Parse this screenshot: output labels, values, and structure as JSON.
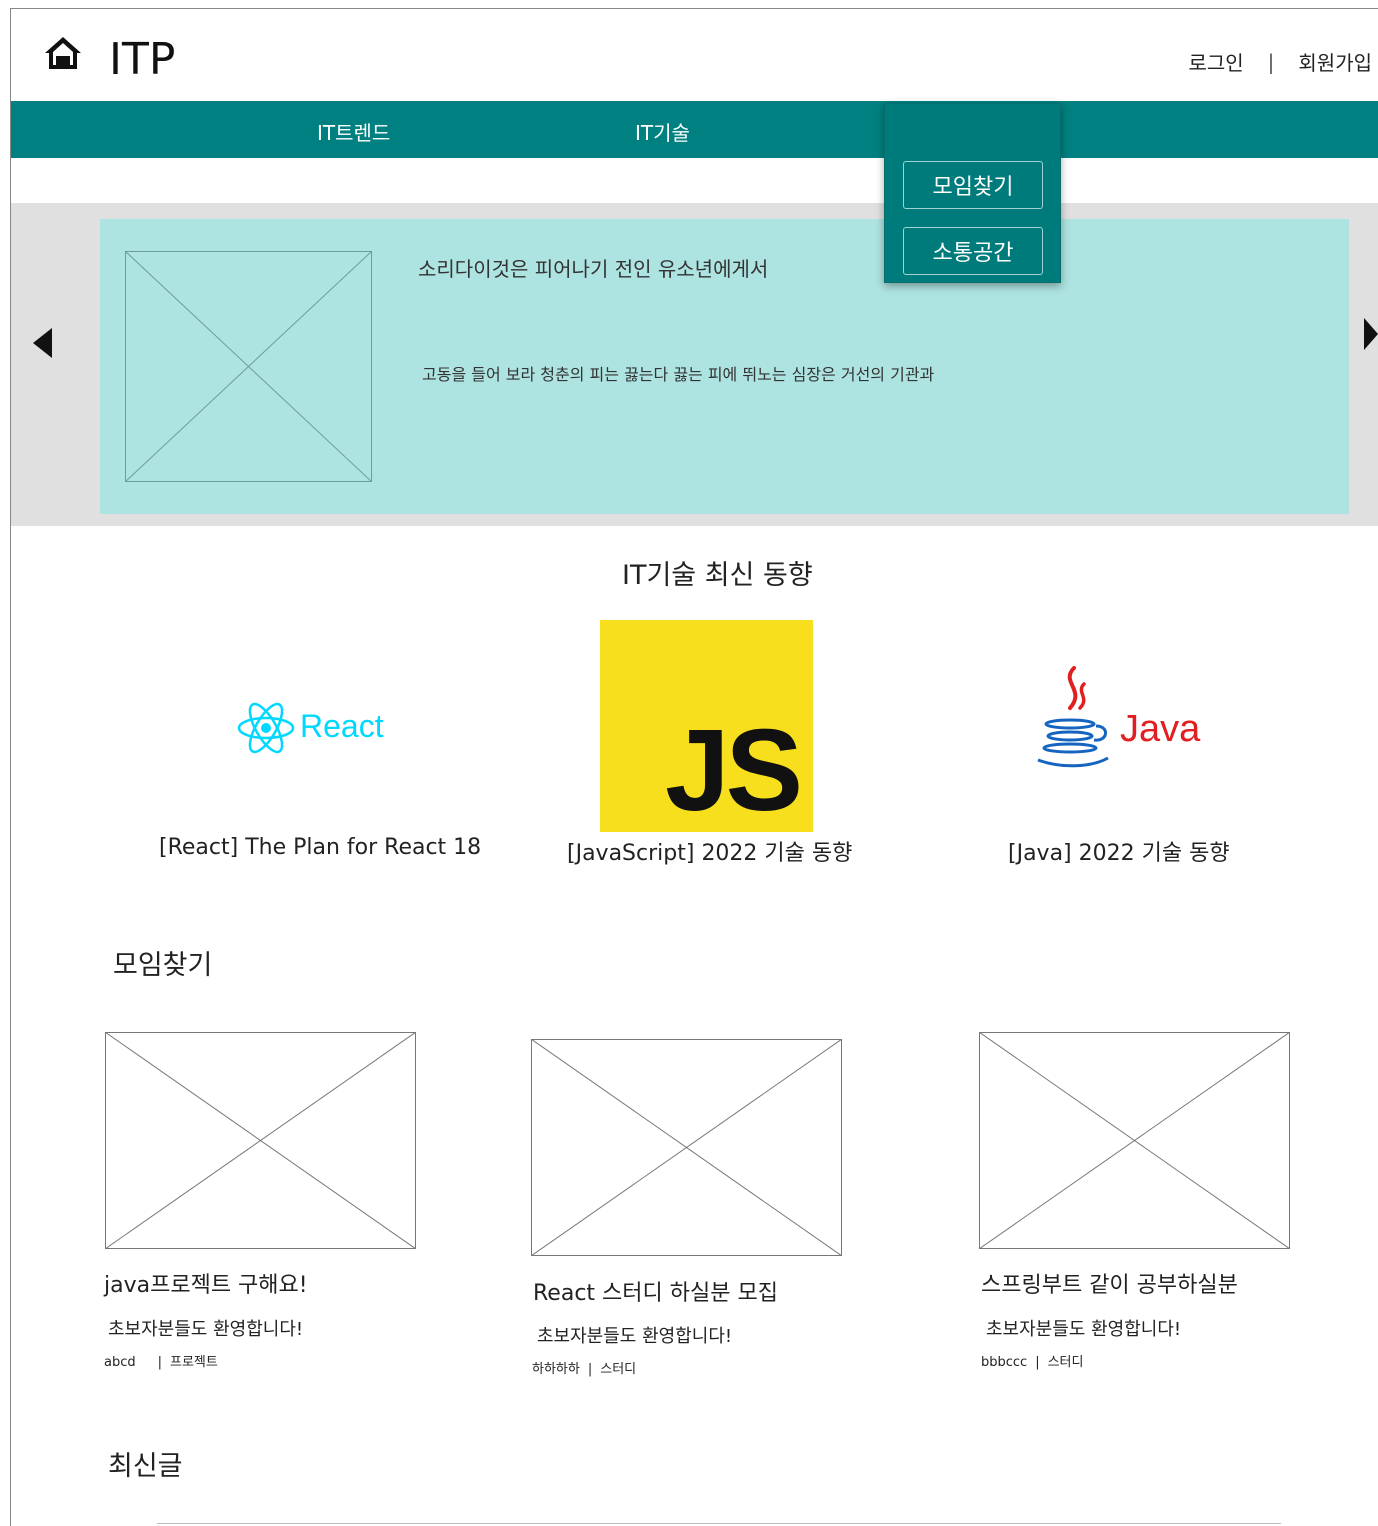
{
  "header": {
    "logo": "ITP",
    "login": "로그인",
    "separator": "|",
    "signup": "회원가입"
  },
  "nav": {
    "items": [
      "IT트렌드",
      "IT기술"
    ]
  },
  "dropdown": {
    "items": [
      "모임찾기",
      "소통공간"
    ]
  },
  "banner": {
    "title": "소리다이것은 피어나기 전인 유소년에게서",
    "description": "고동을 들어 보라 청춘의 피는 끓는다 끓는 피에 뛰노는 심장은 거선의 기관과"
  },
  "tech": {
    "section_title": "IT기술 최신 동향",
    "items": [
      {
        "logo_text": "React",
        "caption": "[React] The Plan for React 18"
      },
      {
        "logo_text": "JS",
        "caption": "[JavaScript] 2022 기술 동향"
      },
      {
        "logo_text": "Java",
        "caption": "[Java] 2022 기술 동향"
      }
    ]
  },
  "meetups": {
    "section_title": "모임찾기",
    "cards": [
      {
        "title": "java프로젝트 구해요!",
        "desc": "초보자분들도 환영합니다!",
        "author": "abcd",
        "category": "프로젝트"
      },
      {
        "title": "React 스터디 하실분 모집",
        "desc": "초보자분들도 환영합니다!",
        "author": "하하하하",
        "category": "스터디"
      },
      {
        "title": "스프링부트 같이 공부하실분",
        "desc": "초보자분들도 환영합니다!",
        "author": "bbbccc",
        "category": "스터디"
      }
    ]
  },
  "recent": {
    "section_title": "최신글"
  },
  "colors": {
    "nav_bg": "#008080",
    "banner_bg": "#ade3e0",
    "react": "#00d8ff",
    "js_bg": "#f7df1e",
    "java_red": "#e11f21",
    "java_blue": "#1565c0"
  }
}
